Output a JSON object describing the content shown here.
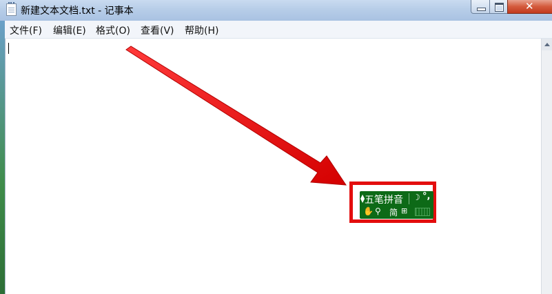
{
  "window": {
    "title": "新建文本文档.txt - 记事本",
    "close_glyph": "✕"
  },
  "menubar": {
    "items": [
      {
        "id": "file",
        "label": "文件(F)"
      },
      {
        "id": "edit",
        "label": "编辑(E)"
      },
      {
        "id": "format",
        "label": "格式(O)"
      },
      {
        "id": "view",
        "label": "查看(V)"
      },
      {
        "id": "help",
        "label": "帮助(H)"
      }
    ]
  },
  "editor": {
    "content": ""
  },
  "ime_toolbar": {
    "name": "五笔拼音",
    "mode_icon": "moon-icon",
    "punct": "°,",
    "simplified": "简",
    "row2_icons": [
      "hand-icon",
      "search-icon",
      "symbol-icon",
      "keyboard-icon"
    ],
    "symbol_glyph": "⊞"
  },
  "annotation": {
    "arrow_color": "#e30e0e",
    "highlight_color": "#e30e0e"
  },
  "colors": {
    "ime_green": "#0d6a17",
    "close_red": "#c23b1f"
  }
}
